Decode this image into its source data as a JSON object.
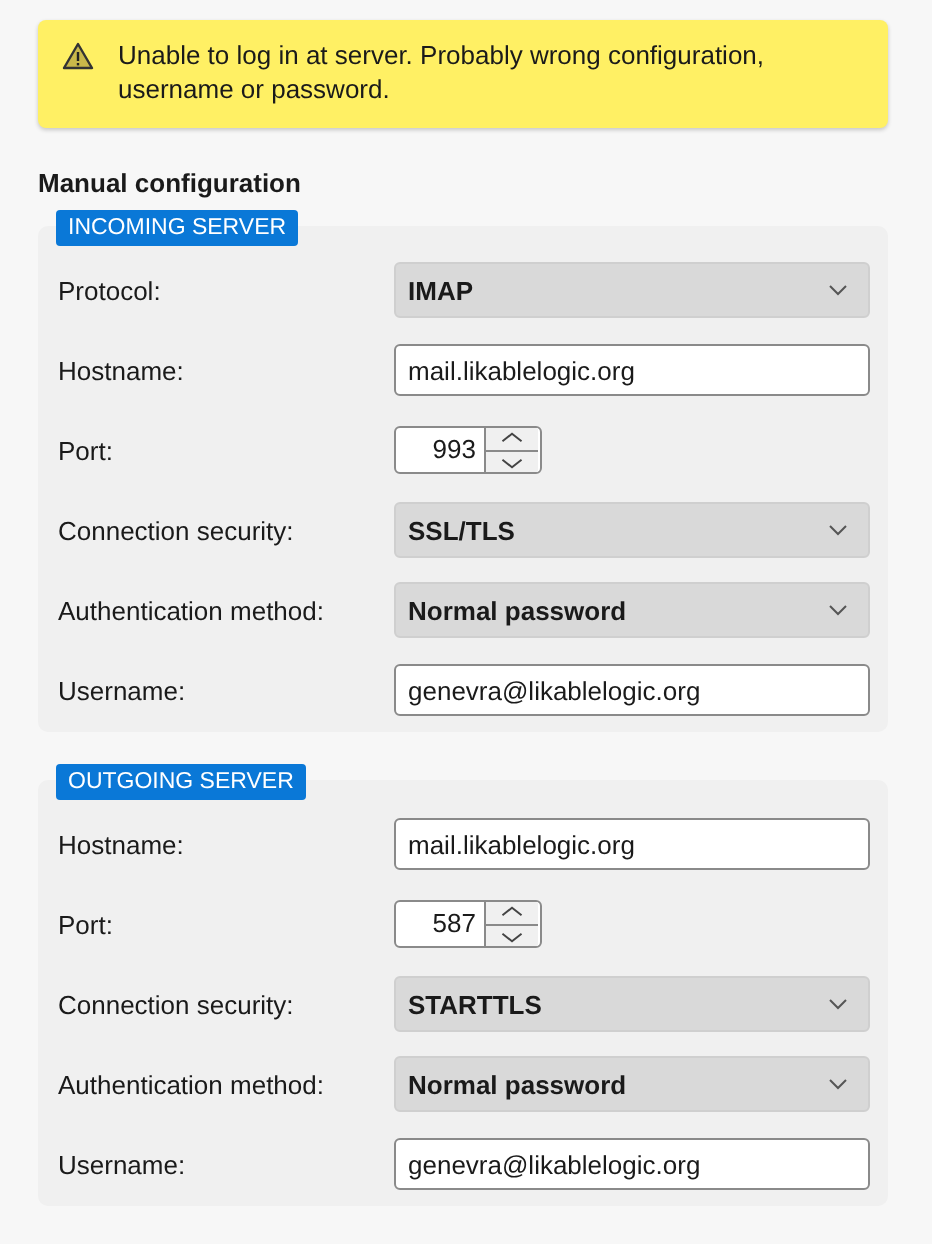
{
  "warning": {
    "message": "Unable to log in at server. Probably wrong configuration, username or password."
  },
  "heading": "Manual configuration",
  "sections": [
    {
      "title": "INCOMING SERVER",
      "fields": [
        {
          "kind": "select",
          "label": "Protocol:",
          "value": "IMAP"
        },
        {
          "kind": "text",
          "label": "Hostname:",
          "value": "mail.likablelogic.org"
        },
        {
          "kind": "spin",
          "label": "Port:",
          "value": "993"
        },
        {
          "kind": "select",
          "label": "Connection security:",
          "value": "SSL/TLS"
        },
        {
          "kind": "select",
          "label": "Authentication method:",
          "value": "Normal password"
        },
        {
          "kind": "text",
          "label": "Username:",
          "value": "genevra@likablelogic.org"
        }
      ]
    },
    {
      "title": "OUTGOING SERVER",
      "fields": [
        {
          "kind": "text",
          "label": "Hostname:",
          "value": "mail.likablelogic.org"
        },
        {
          "kind": "spin",
          "label": "Port:",
          "value": "587"
        },
        {
          "kind": "select",
          "label": "Connection security:",
          "value": "STARTTLS"
        },
        {
          "kind": "select",
          "label": "Authentication method:",
          "value": "Normal password"
        },
        {
          "kind": "text",
          "label": "Username:",
          "value": "genevra@likablelogic.org"
        }
      ]
    }
  ]
}
